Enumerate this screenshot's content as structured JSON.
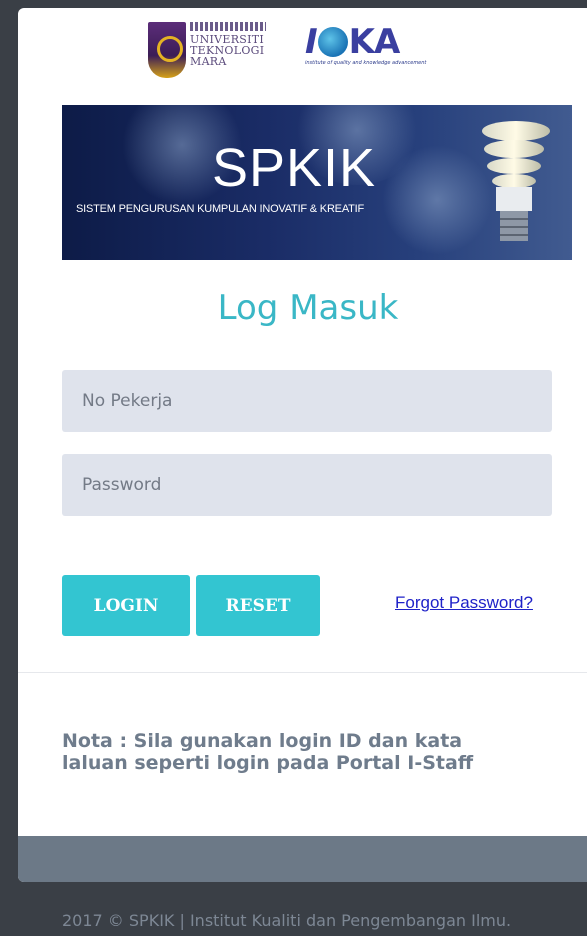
{
  "logos": {
    "uitm_lines": [
      "UNIVERSITI",
      "TEKNOLOGI",
      "MARA"
    ],
    "iqka_word": "IQKA",
    "iqka_tagline": "institute of quality and knowledge advancement"
  },
  "banner": {
    "title": "SPKIK",
    "subtitle": "SISTEM PENGURUSAN KUMPULAN INOVATIF & KREATIF"
  },
  "form": {
    "heading": "Log Masuk",
    "employee_no": {
      "placeholder": "No Pekerja",
      "value": ""
    },
    "password": {
      "placeholder": "Password",
      "value": ""
    },
    "login_label": "LOGIN",
    "reset_label": "RESET",
    "forgot_label": "Forgot Password?"
  },
  "note": "Nota : Sila gunakan login ID dan kata laluan seperti login pada Portal I-Staff",
  "footer": "2017 © SPKIK | Institut Kualiti dan Pengembangan Ilmu.",
  "colors": {
    "accent": "#33c5d1",
    "heading": "#3ab7c6",
    "page_bg": "#3a3f46",
    "card_footer": "#6c7987",
    "input_bg": "#dfe3ec",
    "link": "#1f22c8"
  }
}
